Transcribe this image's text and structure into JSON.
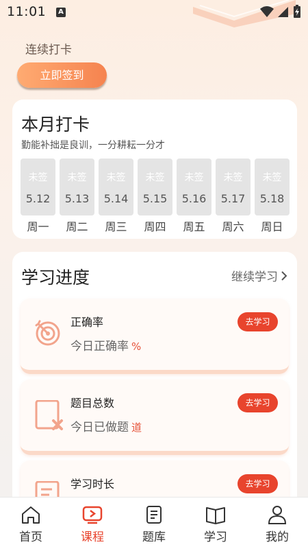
{
  "status_bar": {
    "time": "11:01",
    "notification_letter": "A"
  },
  "header": {
    "streak_label": "连续打卡",
    "sign_in_button": "立即签到"
  },
  "month_card": {
    "title": "本月打卡",
    "subtitle": "勤能补拙是良训，一分耕耘一分才",
    "days": [
      {
        "status": "未签",
        "date": "5.12",
        "weekday": "周一"
      },
      {
        "status": "未签",
        "date": "5.13",
        "weekday": "周二"
      },
      {
        "status": "未签",
        "date": "5.14",
        "weekday": "周三"
      },
      {
        "status": "未签",
        "date": "5.15",
        "weekday": "周四"
      },
      {
        "status": "未签",
        "date": "5.16",
        "weekday": "周五"
      },
      {
        "status": "未签",
        "date": "5.17",
        "weekday": "周六"
      },
      {
        "status": "未签",
        "date": "5.18",
        "weekday": "周日"
      }
    ]
  },
  "progress_card": {
    "title": "学习进度",
    "continue_label": "继续学习",
    "items": [
      {
        "title": "正确率",
        "subtitle": "今日正确率",
        "unit": "%",
        "button": "去学习",
        "icon": "target-icon"
      },
      {
        "title": "题目总数",
        "subtitle": "今日已做题",
        "unit": "道",
        "button": "去学习",
        "icon": "document-cross-icon"
      },
      {
        "title": "学习时长",
        "subtitle": "",
        "unit": "",
        "button": "去学习",
        "icon": "clock-doc-icon"
      }
    ]
  },
  "tabbar": {
    "tabs": [
      {
        "label": "首页",
        "icon": "home-icon",
        "active": false
      },
      {
        "label": "课程",
        "icon": "play-icon",
        "active": true
      },
      {
        "label": "题库",
        "icon": "doc-icon",
        "active": false
      },
      {
        "label": "学习",
        "icon": "book-icon",
        "active": false
      },
      {
        "label": "我的",
        "icon": "person-icon",
        "active": false
      }
    ]
  },
  "colors": {
    "accent": "#e8442d",
    "button_gradient_start": "#ffab72",
    "button_gradient_end": "#f5834f"
  }
}
